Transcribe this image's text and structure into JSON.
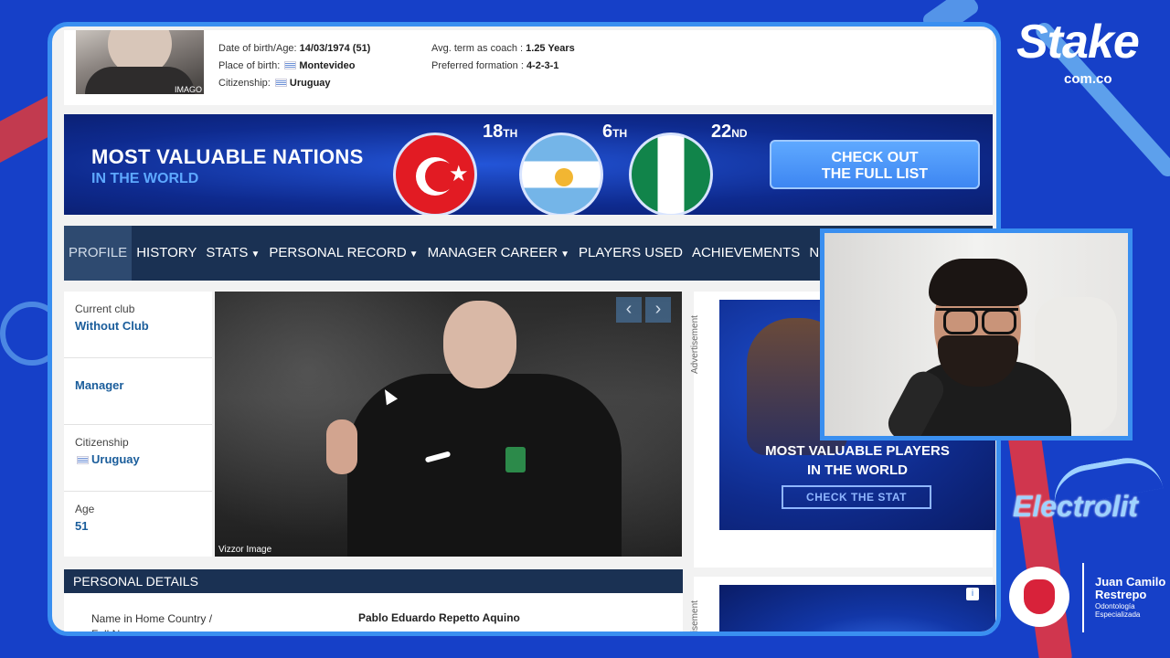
{
  "header": {
    "photo_credit": "IMAGO",
    "dob_label": "Date of birth/Age:",
    "dob_value": "14/03/1974 (51)",
    "pob_label": "Place of birth:",
    "pob_value": "Montevideo",
    "citizenship_label": "Citizenship:",
    "citizenship_value": "Uruguay",
    "term_label": "Avg. term as coach :",
    "term_value": "1.25 Years",
    "formation_label": "Preferred formation :",
    "formation_value": "4-2-3-1"
  },
  "banner": {
    "title": "MOST VALUABLE NATIONS",
    "subtitle": "IN THE WORLD",
    "ranks": [
      {
        "num": "18",
        "suffix": "TH"
      },
      {
        "num": "6",
        "suffix": "TH"
      },
      {
        "num": "22",
        "suffix": "ND"
      }
    ],
    "cta_line1": "CHECK OUT",
    "cta_line2": "THE FULL LIST"
  },
  "nav": {
    "items": [
      {
        "label": "PROFILE",
        "active": true,
        "dropdown": false
      },
      {
        "label": "HISTORY",
        "active": false,
        "dropdown": false
      },
      {
        "label": "STATS",
        "active": false,
        "dropdown": true
      },
      {
        "label": "PERSONAL RECORD",
        "active": false,
        "dropdown": true
      },
      {
        "label": "MANAGER CAREER",
        "active": false,
        "dropdown": true
      },
      {
        "label": "PLAYERS USED",
        "active": false,
        "dropdown": false
      },
      {
        "label": "ACHIEVEMENTS",
        "active": false,
        "dropdown": false
      },
      {
        "label": "NEWS",
        "active": false,
        "dropdown": false
      }
    ],
    "caret": "▼"
  },
  "sidebar": {
    "club_label": "Current club",
    "club_value": "Without Club",
    "role_value": "Manager",
    "citizenship_label": "Citizenship",
    "citizenship_value": "Uruguay",
    "age_label": "Age",
    "age_value": "51"
  },
  "main_photo": {
    "credit": "Vizzor Image",
    "prev_icon": "‹",
    "next_icon": "›"
  },
  "personal_details": {
    "title": "PERSONAL DETAILS",
    "name_label": "Name in Home Country / Full Name:",
    "name_value": "Pablo Eduardo Repetto Aquino"
  },
  "ads": {
    "vertical_label": "Advertisement",
    "title_line1": "MOST VALUABLE PLAYERS",
    "title_line2": "IN THE WORLD",
    "cta": "CHECK THE STAT",
    "info_icon": "i"
  },
  "sponsors": {
    "stake": "Stake",
    "stake_sub": "com.co",
    "electrolit": "Electrolit",
    "dentist_name_1": "Juan Camilo",
    "dentist_name_2": "Restrepo",
    "dentist_tag_1": "Odontología",
    "dentist_tag_2": "Especializada"
  },
  "colors": {
    "overlay_bg": "#1640c8",
    "frame_accent": "#3a8ff0",
    "nav_bg": "#1a3153",
    "link_blue": "#1a5d9b"
  }
}
